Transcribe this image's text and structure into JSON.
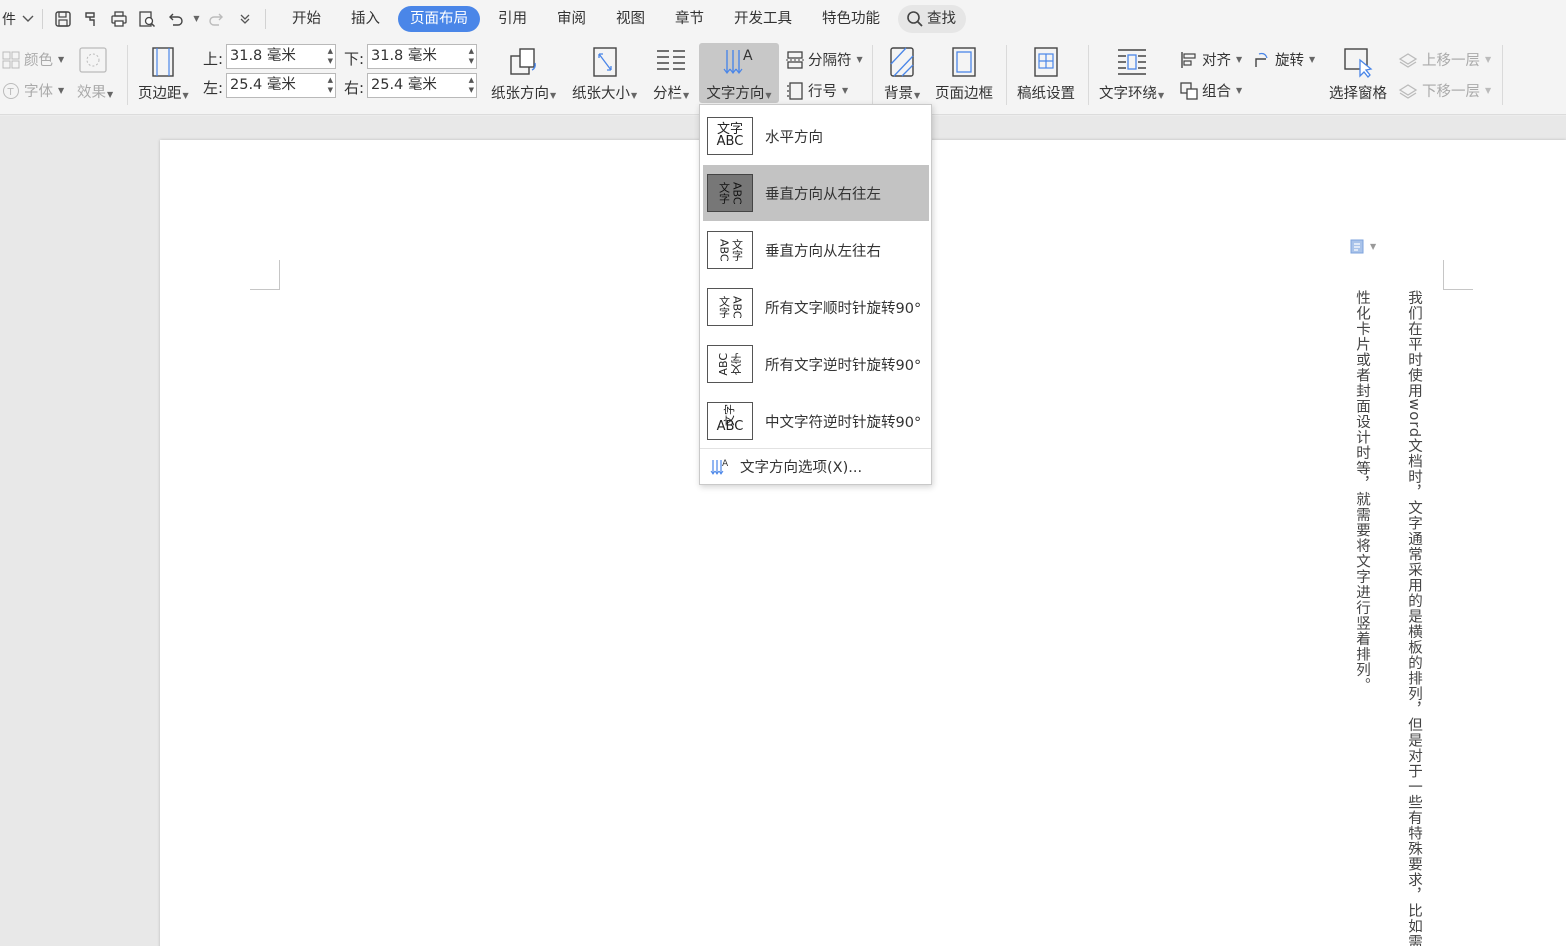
{
  "menubar": {
    "file_label": "件",
    "tabs": [
      {
        "label": "开始"
      },
      {
        "label": "插入"
      },
      {
        "label": "页面布局"
      },
      {
        "label": "引用"
      },
      {
        "label": "审阅"
      },
      {
        "label": "视图"
      },
      {
        "label": "章节"
      },
      {
        "label": "开发工具"
      },
      {
        "label": "特色功能"
      }
    ],
    "search_label": "查找",
    "accent_color": "#4a86e8"
  },
  "ribbon": {
    "theme_colors": "颜色",
    "theme_fonts": "字体",
    "theme_effects": "效果",
    "margins": "页边距",
    "top_label": "上:",
    "top_value": "31.8 毫米",
    "bottom_label": "下:",
    "bottom_value": "31.8 毫米",
    "left_label": "左:",
    "left_value": "25.4 毫米",
    "right_label": "右:",
    "right_value": "25.4 毫米",
    "orientation": "纸张方向",
    "size": "纸张大小",
    "columns": "分栏",
    "text_direction": "文字方向",
    "breaks": "分隔符",
    "line_numbers": "行号",
    "background": "背景",
    "page_border": "页面边框",
    "manuscript": "稿纸设置",
    "wrap_text": "文字环绕",
    "align": "对齐",
    "rotate": "旋转",
    "group": "组合",
    "selection_pane": "选择窗格",
    "bring_forward": "上移一层",
    "send_backward": "下移一层"
  },
  "dropdown": {
    "items": [
      {
        "label": "水平方向",
        "icon_top": "文字",
        "icon_bottom": "ABC"
      },
      {
        "label": "垂直方向从右往左",
        "icon_top": "ABC",
        "icon_bottom": "文字"
      },
      {
        "label": "垂直方向从左往右",
        "icon_top": "ABC",
        "icon_bottom": "文字"
      },
      {
        "label": "所有文字顺时针旋转90°",
        "icon_top": "ABC",
        "icon_bottom": "文字"
      },
      {
        "label": "所有文字逆时针旋转90°",
        "icon_top": "ABC",
        "icon_bottom": "文字"
      },
      {
        "label": "中文字符逆时针旋转90°",
        "icon_top": "文字",
        "icon_bottom": "ABC"
      }
    ],
    "options_label": "文字方向选项(X)..."
  },
  "document": {
    "column_1": "我们在平时使用word文档时，文字通常采用的是横板的排列，但是对于一些有特殊要求，比如需要设",
    "column_2": "性化卡片或者封面设计时等，就需要将文字进行竖着排列。"
  }
}
